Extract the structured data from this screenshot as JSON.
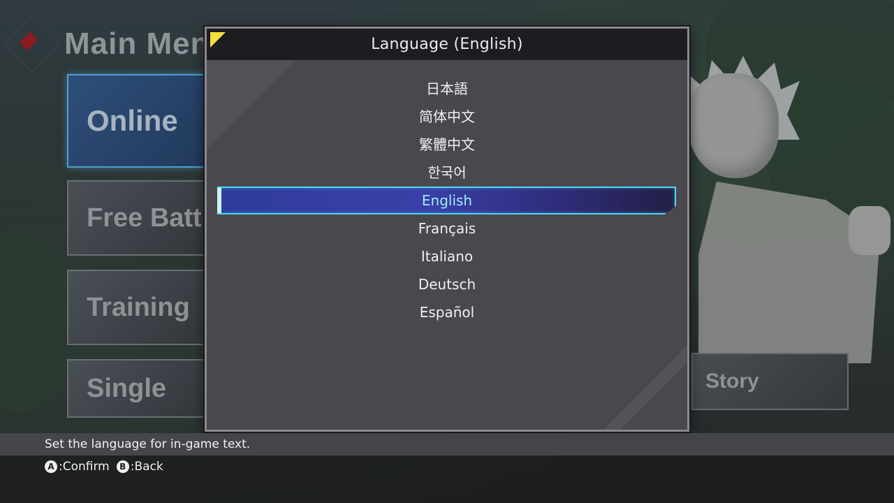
{
  "main_menu": {
    "title": "Main Men",
    "cards": [
      "Online",
      "Free Batt",
      "Training",
      "Single"
    ],
    "story_label": "Story"
  },
  "dialog": {
    "title": "Language (English)",
    "languages": [
      {
        "label": "日本語",
        "selected": false
      },
      {
        "label": "简体中文",
        "selected": false
      },
      {
        "label": "繁體中文",
        "selected": false
      },
      {
        "label": "한국어",
        "selected": false
      },
      {
        "label": "English",
        "selected": true
      },
      {
        "label": "Français",
        "selected": false
      },
      {
        "label": "Italiano",
        "selected": false
      },
      {
        "label": "Deutsch",
        "selected": false
      },
      {
        "label": "Español",
        "selected": false
      }
    ]
  },
  "help": {
    "text": "Set the language for in-game text."
  },
  "controls": {
    "confirm_button": "A",
    "confirm_label": ":Confirm",
    "back_button": "B",
    "back_label": ":Back"
  },
  "colors": {
    "accent": "#4fd8f0",
    "corner_marker": "#f4e23a",
    "selected_text": "#9fe8ff"
  }
}
